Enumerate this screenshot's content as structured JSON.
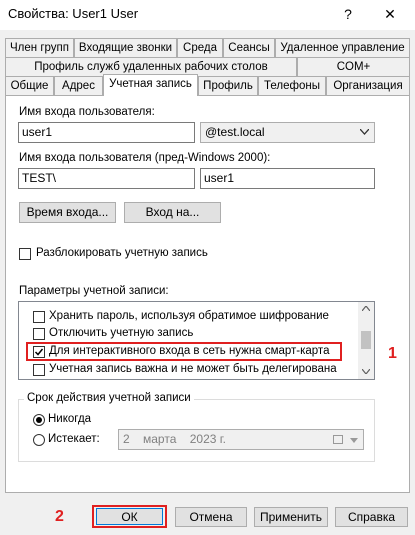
{
  "window": {
    "title": "Свойства: User1 User",
    "help_glyph": "?",
    "close_glyph": "✕"
  },
  "tabs": {
    "row1": [
      "Член групп",
      "Входящие звонки",
      "Среда",
      "Сеансы",
      "Удаленное управление"
    ],
    "row2": [
      "Профиль служб удаленных рабочих столов",
      "COM+"
    ],
    "row3": [
      "Общие",
      "Адрес",
      "Учетная запись",
      "Профиль",
      "Телефоны",
      "Организация"
    ]
  },
  "account": {
    "logon_label": "Имя входа пользователя:",
    "logon_value": "user1",
    "domain_value": "@test.local",
    "pre2000_label": "Имя входа пользователя (пред-Windows 2000):",
    "pre2000_domain": "TEST\\",
    "pre2000_user": "user1",
    "logon_hours_button": "Время входа...",
    "logon_to_button": "Вход на...",
    "unlock_label": "Разблокировать учетную запись",
    "options_label": "Параметры учетной записи:",
    "options": [
      {
        "label": "Хранить пароль, используя обратимое шифрование",
        "checked": false
      },
      {
        "label": "Отключить учетную запись",
        "checked": false
      },
      {
        "label": "Для интерактивного входа в сеть нужна смарт-карта",
        "checked": true
      },
      {
        "label": "Учетная запись важна и не может быть делегирована",
        "checked": false
      }
    ],
    "expires_group_label": "Срок действия учетной записи",
    "never_label": "Никогда",
    "end_of_label": "Истекает:",
    "expire_date": "2    марта    2023 г."
  },
  "annotations": {
    "one": "1",
    "two": "2"
  },
  "buttons": {
    "ok": "ОК",
    "cancel": "Отмена",
    "apply": "Применить",
    "help": "Справка"
  }
}
